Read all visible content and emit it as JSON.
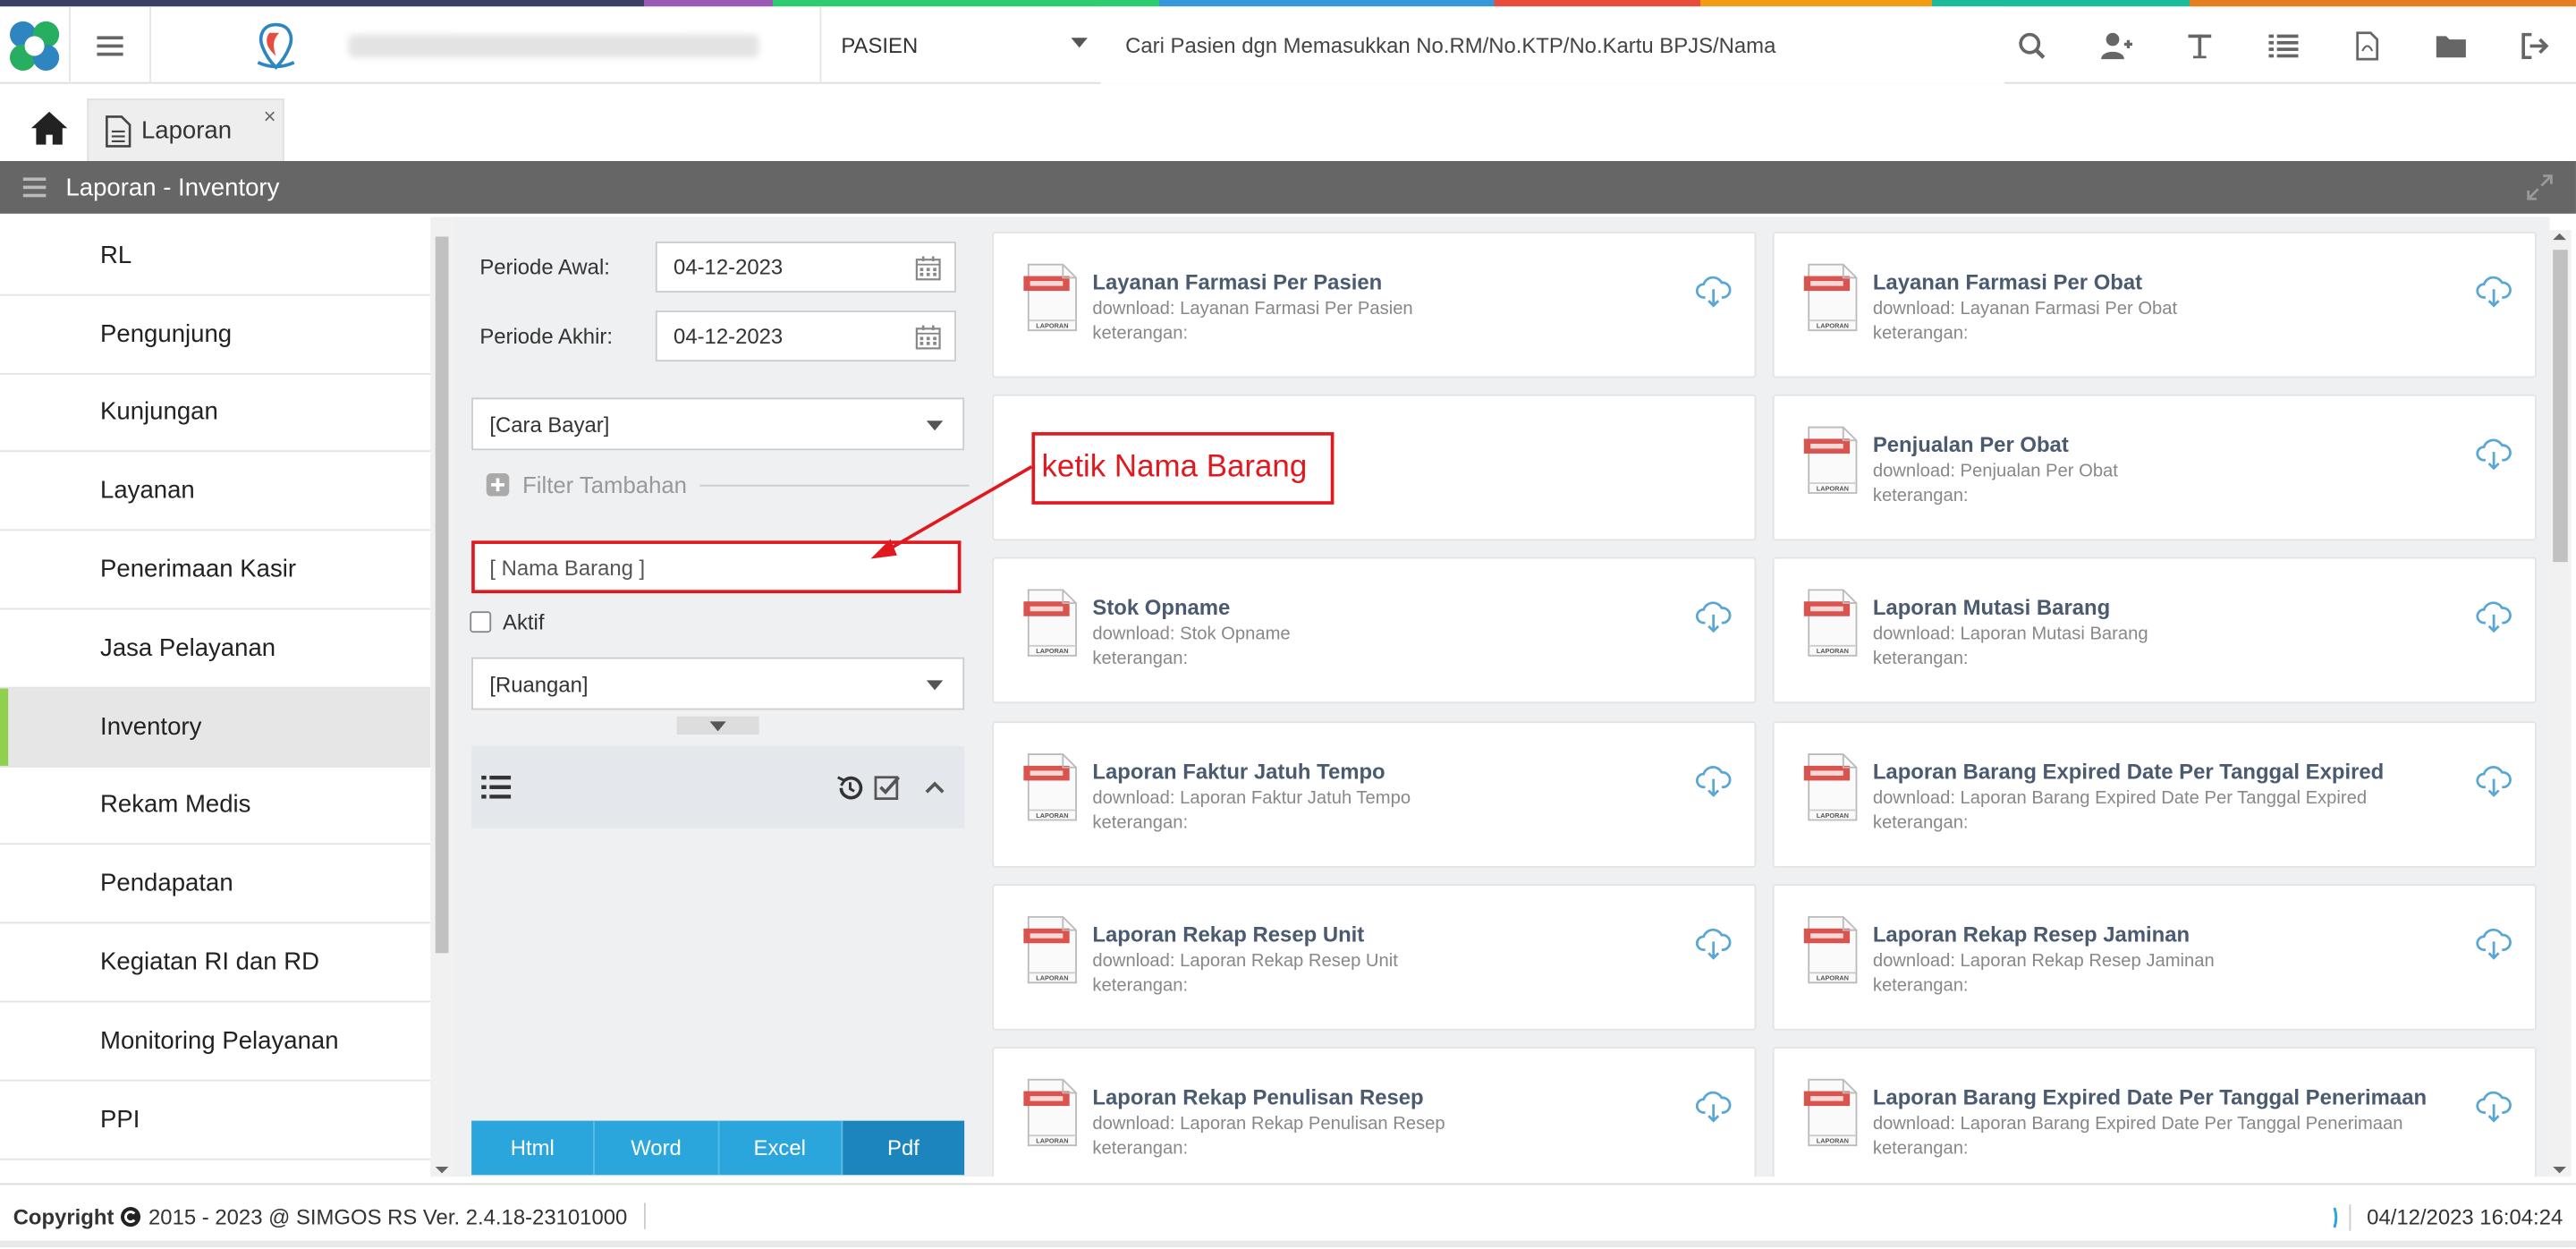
{
  "header": {
    "search_type": "PASIEN",
    "search_placeholder": "Cari Pasien dgn Memasukkan No.RM/No.KTP/No.Kartu BPJS/Nama",
    "icons": [
      "search-icon",
      "add-user-icon",
      "text-icon",
      "list-icon",
      "pdf-icon",
      "folder-icon",
      "logout-icon"
    ]
  },
  "tabs": [
    {
      "label": "Laporan"
    }
  ],
  "tab_close": "×",
  "page_title": "Laporan - Inventory",
  "sidebar": {
    "items": [
      {
        "label": "RL"
      },
      {
        "label": "Pengunjung"
      },
      {
        "label": "Kunjungan"
      },
      {
        "label": "Layanan"
      },
      {
        "label": "Penerimaan Kasir"
      },
      {
        "label": "Jasa Pelayanan"
      },
      {
        "label": "Inventory",
        "active": true
      },
      {
        "label": "Rekam Medis"
      },
      {
        "label": "Pendapatan"
      },
      {
        "label": "Kegiatan RI dan RD"
      },
      {
        "label": "Monitoring Pelayanan"
      },
      {
        "label": "PPI"
      }
    ]
  },
  "filter": {
    "periode_awal_label": "Periode Awal:",
    "periode_awal_value": "04-12-2023",
    "periode_akhir_label": "Periode Akhir:",
    "periode_akhir_value": "04-12-2023",
    "cara_bayar": "[Cara Bayar]",
    "filter_tambahan": "Filter Tambahan",
    "nama_barang_placeholder": "[ Nama Barang ]",
    "aktif_label": "Aktif",
    "ruangan": "[Ruangan]",
    "export_buttons": [
      {
        "label": "Html"
      },
      {
        "label": "Word"
      },
      {
        "label": "Excel"
      },
      {
        "label": "Pdf",
        "active": true
      }
    ]
  },
  "annotation": {
    "text": "ketik Nama Barang",
    "color": "#e0191f"
  },
  "reports": [
    {
      "title": "Layanan Farmasi Per Pasien",
      "download": "download: Layanan Farmasi Per Pasien",
      "keterangan": "keterangan:"
    },
    {
      "title": "Layanan Farmasi Per Obat",
      "download": "download: Layanan Farmasi Per Obat",
      "keterangan": "keterangan:"
    },
    {
      "title": "",
      "download": "",
      "keterangan": ""
    },
    {
      "title": "Penjualan Per Obat",
      "download": "download: Penjualan Per Obat",
      "keterangan": "keterangan:"
    },
    {
      "title": "Stok Opname",
      "download": "download: Stok Opname",
      "keterangan": "keterangan:"
    },
    {
      "title": "Laporan Mutasi Barang",
      "download": "download: Laporan Mutasi Barang",
      "keterangan": "keterangan:"
    },
    {
      "title": "Laporan Faktur Jatuh Tempo",
      "download": "download: Laporan Faktur Jatuh Tempo",
      "keterangan": "keterangan:"
    },
    {
      "title": "Laporan Barang Expired Date Per Tanggal Expired",
      "download": "download: Laporan Barang Expired Date Per Tanggal Expired",
      "keterangan": "keterangan:"
    },
    {
      "title": "Laporan Rekap Resep Unit",
      "download": "download: Laporan Rekap Resep Unit",
      "keterangan": "keterangan:"
    },
    {
      "title": "Laporan Rekap Resep Jaminan",
      "download": "download: Laporan Rekap Resep Jaminan",
      "keterangan": "keterangan:"
    },
    {
      "title": "Laporan Rekap Penulisan Resep",
      "download": "download: Laporan Rekap Penulisan Resep",
      "keterangan": "keterangan:"
    },
    {
      "title": "Laporan Barang Expired Date Per Tanggal Penerimaan",
      "download": "download: Laporan Barang Expired Date Per Tanggal Penerimaan",
      "keterangan": "keterangan:"
    }
  ],
  "doc_icon_label": "LAPORAN",
  "footer": {
    "copyright_label": "Copyright",
    "copyright_text": "2015 - 2023 @ SIMGOS RS Ver. 2.4.18-23101000",
    "datetime": "04/12/2023 16:04:24"
  },
  "colors": {
    "accent": "#2aa6dd",
    "accent_active": "#1c85bd",
    "sidebar_active_marker": "#8fd14f",
    "titlebar": "#666666",
    "annotation": "#e0191f"
  }
}
